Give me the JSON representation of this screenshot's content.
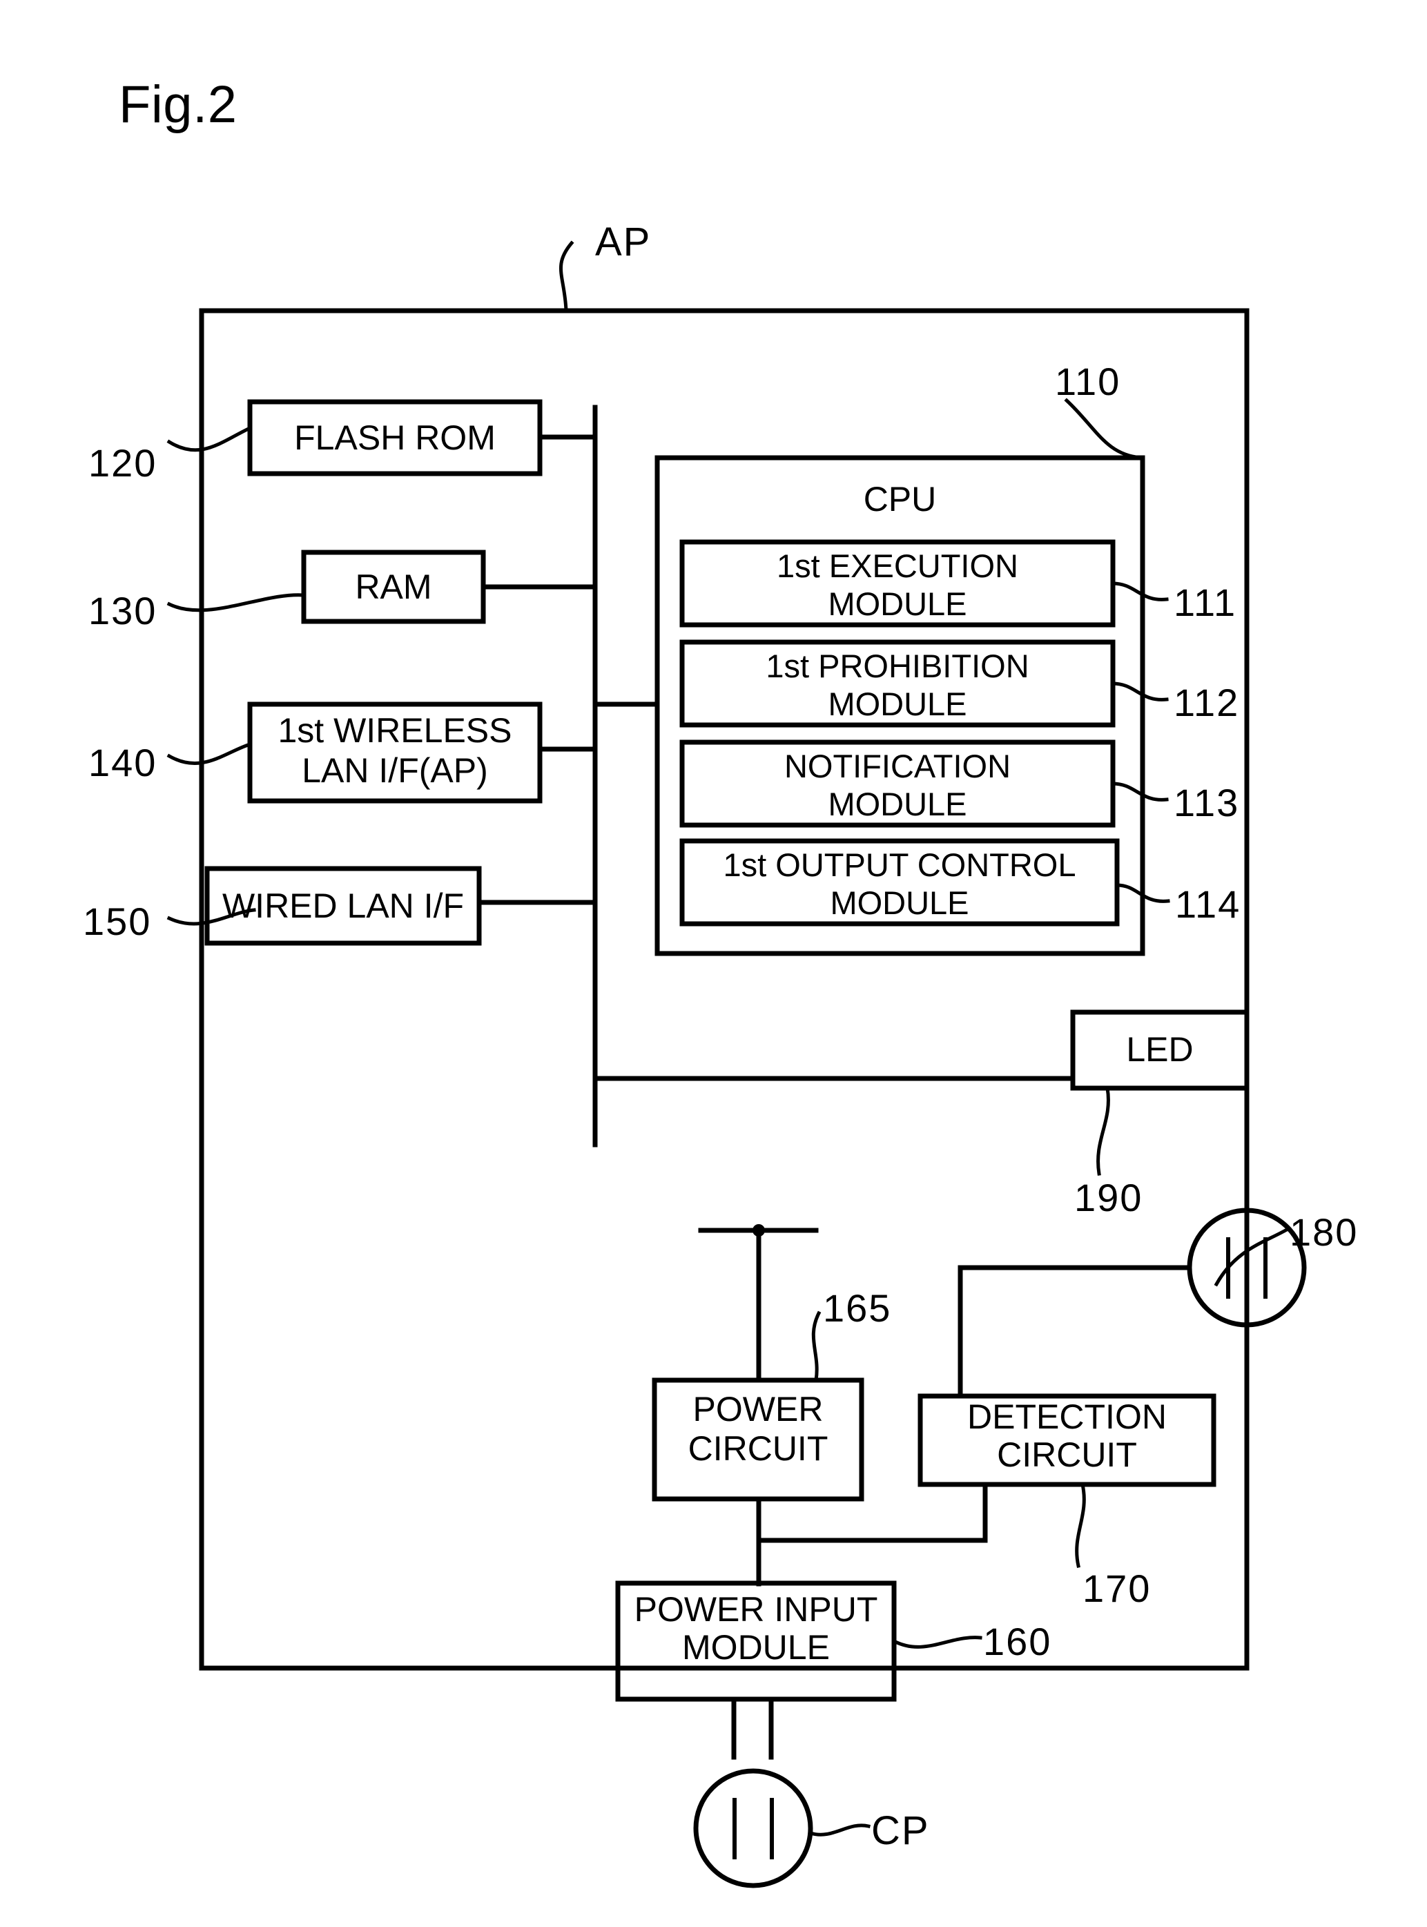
{
  "figure": {
    "title": "Fig.2",
    "device_label": "AP",
    "connector_label": "CP"
  },
  "outer_box": {
    "name": "AP",
    "ref": "AP"
  },
  "cpu": {
    "title": "CPU",
    "ref": "110",
    "modules": [
      {
        "label": "1st EXECUTION\nMODULE",
        "line1": "1st EXECUTION",
        "line2": "MODULE",
        "ref": "111"
      },
      {
        "label": "1st PROHIBITION\nMODULE",
        "line1": "1st PROHIBITION",
        "line2": "MODULE",
        "ref": "112"
      },
      {
        "label": "NOTIFICATION\nMODULE",
        "line1": "NOTIFICATION",
        "line2": "MODULE",
        "ref": "113"
      },
      {
        "label": "1st OUTPUT CONTROL\nMODULE",
        "line1": "1st OUTPUT CONTROL",
        "line2": "MODULE",
        "ref": "114"
      }
    ]
  },
  "left_blocks": [
    {
      "line1": "FLASH ROM",
      "line2": "",
      "ref": "120"
    },
    {
      "line1": "RAM",
      "line2": "",
      "ref": "130"
    },
    {
      "line1": "1st WIRELESS",
      "line2": "LAN I/F(AP)",
      "ref": "140"
    },
    {
      "line1": "WIRED LAN I/F",
      "line2": "",
      "ref": "150"
    }
  ],
  "indicator": {
    "line1": "LED",
    "line2": "",
    "ref": "190"
  },
  "power_section": {
    "power_circuit": {
      "line1": "POWER",
      "line2": "CIRCUIT",
      "ref": "165"
    },
    "detection_circuit": {
      "line1": "DETECTION",
      "line2": "CIRCUIT",
      "ref": "170"
    },
    "power_input_module": {
      "line1": "POWER INPUT",
      "line2": "MODULE",
      "ref": "160"
    }
  },
  "connectors": [
    {
      "ref": "180",
      "name": "ac-inlet-connector"
    },
    {
      "ref": "CP",
      "name": "power-plug-connector"
    }
  ]
}
